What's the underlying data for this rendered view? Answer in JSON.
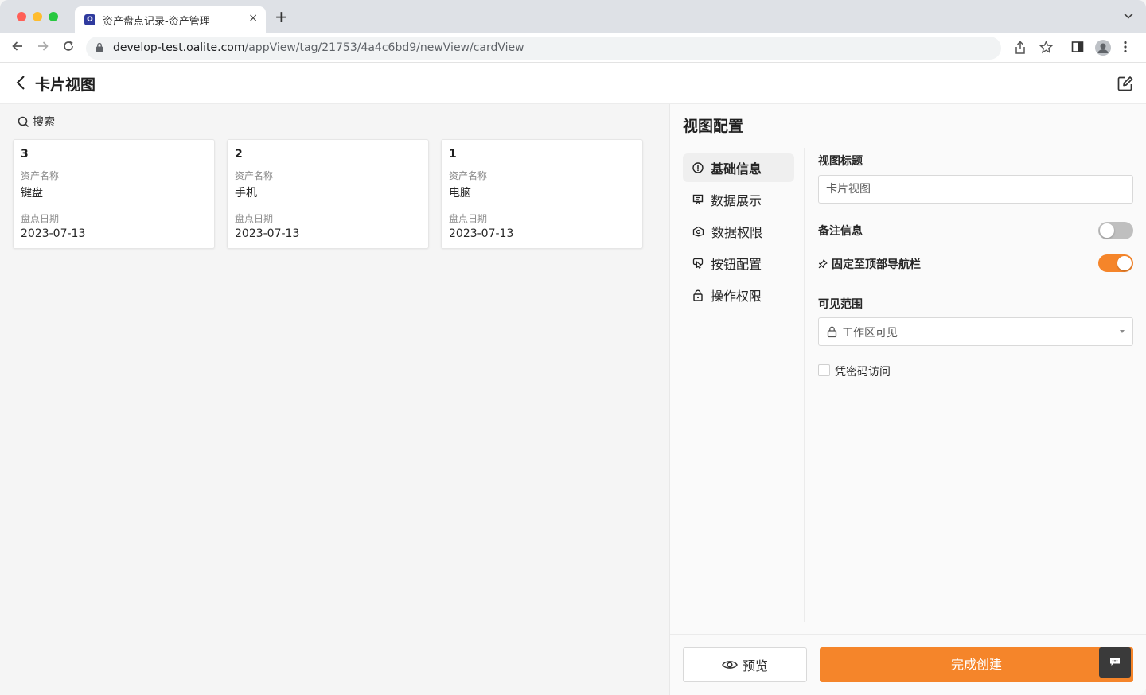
{
  "browser": {
    "tab_title": "资产盘点记录-资产管理",
    "favicon_letter": "O",
    "url_host": "develop-test.oalite.com",
    "url_path": "/appView/tag/21753/4a4c6bd9/newView/cardView",
    "new_tab": "+",
    "tab_close": "×",
    "tab_menu": "⌄"
  },
  "header": {
    "title": "卡片视图"
  },
  "left": {
    "search_label": "搜索",
    "cards": [
      {
        "id": "3",
        "name_label": "资产名称",
        "name": "键盘",
        "date_label": "盘点日期",
        "date": "2023-07-13"
      },
      {
        "id": "2",
        "name_label": "资产名称",
        "name": "手机",
        "date_label": "盘点日期",
        "date": "2023-07-13"
      },
      {
        "id": "1",
        "name_label": "资产名称",
        "name": "电脑",
        "date_label": "盘点日期",
        "date": "2023-07-13"
      }
    ]
  },
  "panel": {
    "heading": "视图配置",
    "menu": [
      {
        "label": "基础信息",
        "icon": "info-circle-icon",
        "active": true
      },
      {
        "label": "数据展示",
        "icon": "display-icon",
        "active": false
      },
      {
        "label": "数据权限",
        "icon": "data-permission-icon",
        "active": false
      },
      {
        "label": "按钮配置",
        "icon": "button-config-icon",
        "active": false
      },
      {
        "label": "操作权限",
        "icon": "lock-icon",
        "active": false
      }
    ],
    "view_title_label": "视图标题",
    "view_title_value": "卡片视图",
    "remark_label": "备注信息",
    "remark_enabled": false,
    "pin_label": "固定至顶部导航栏",
    "pin_enabled": true,
    "visibility_label": "可见范围",
    "visibility_value": "工作区可见",
    "password_label": "凭密码访问",
    "password_checked": false,
    "preview_button": "预览",
    "finish_button": "完成创建",
    "accent_color": "#f5852a"
  }
}
